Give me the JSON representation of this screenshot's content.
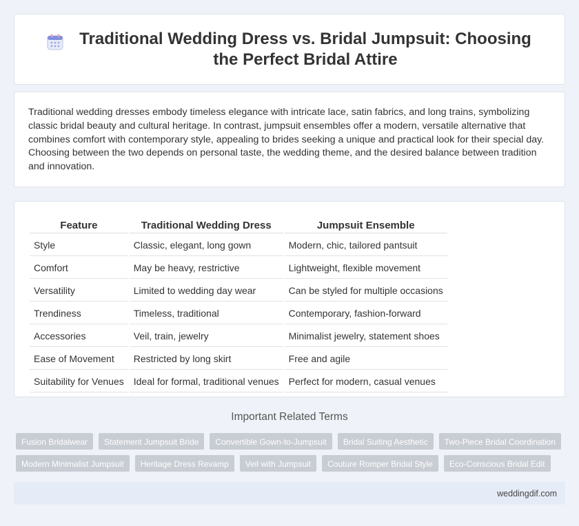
{
  "header": {
    "title": "Traditional Wedding Dress vs. Bridal Jumpsuit: Choosing the Perfect Bridal Attire",
    "icon": "calendar-icon"
  },
  "intro": {
    "text": "Traditional wedding dresses embody timeless elegance with intricate lace, satin fabrics, and long trains, symbolizing classic bridal beauty and cultural heritage. In contrast, jumpsuit ensembles offer a modern, versatile alternative that combines comfort with contemporary style, appealing to brides seeking a unique and practical look for their special day. Choosing between the two depends on personal taste, the wedding theme, and the desired balance between tradition and innovation."
  },
  "table": {
    "headers": [
      "Feature",
      "Traditional Wedding Dress",
      "Jumpsuit Ensemble"
    ],
    "rows": [
      [
        "Style",
        "Classic, elegant, long gown",
        "Modern, chic, tailored pantsuit"
      ],
      [
        "Comfort",
        "May be heavy, restrictive",
        "Lightweight, flexible movement"
      ],
      [
        "Versatility",
        "Limited to wedding day wear",
        "Can be styled for multiple occasions"
      ],
      [
        "Trendiness",
        "Timeless, traditional",
        "Contemporary, fashion-forward"
      ],
      [
        "Accessories",
        "Veil, train, jewelry",
        "Minimalist jewelry, statement shoes"
      ],
      [
        "Ease of Movement",
        "Restricted by long skirt",
        "Free and agile"
      ],
      [
        "Suitability for Venues",
        "Ideal for formal, traditional venues",
        "Perfect for modern, casual venues"
      ]
    ]
  },
  "related": {
    "title": "Important Related Terms",
    "row1": [
      "Fusion Bridalwear",
      "Statement Jumpsuit Bride",
      "Convertible Gown-to-Jumpsuit",
      "Bridal Suiting Aesthetic",
      "Two-Piece Bridal Coordination"
    ],
    "row2": [
      "Modern Minimalist Jumpsuit",
      "Heritage Dress Revamp",
      "Veil with Jumpsuit",
      "Couture Romper Bridal Style",
      "Eco-Conscious Bridal Edit"
    ]
  },
  "footer": {
    "site": "weddingdif.com"
  },
  "colors": {
    "background": "#eff2f8",
    "tag": "#c8ccd3",
    "footer": "#e6ecf7"
  }
}
